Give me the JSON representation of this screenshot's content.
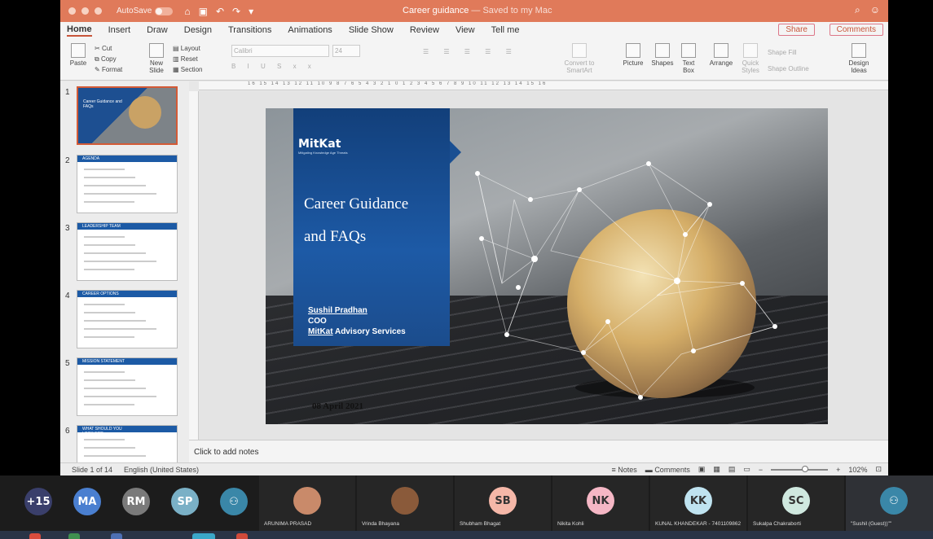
{
  "titlebar": {
    "autosave": "AutoSave",
    "autosave_state": "OFF",
    "doc_title": "Career guidance",
    "saved_status": "— Saved to my Mac"
  },
  "tabs": [
    "Home",
    "Insert",
    "Draw",
    "Design",
    "Transitions",
    "Animations",
    "Slide Show",
    "Review",
    "View",
    "Tell me"
  ],
  "tab_actions": {
    "share": "Share",
    "comments": "Comments"
  },
  "ribbon": {
    "paste": "Paste",
    "cut": "Cut",
    "copy": "Copy",
    "format": "Format",
    "new_slide": "New\nSlide",
    "layout": "Layout",
    "reset": "Reset",
    "section": "Section",
    "font": "Calibri",
    "font_size": "24",
    "convert": "Convert to SmartArt",
    "picture": "Picture",
    "shapes": "Shapes",
    "text_box": "Text Box",
    "arrange": "Arrange",
    "quick_styles": "Quick Styles",
    "shape_fill": "Shape Fill",
    "shape_outline": "Shape Outline",
    "design_ideas": "Design Ideas"
  },
  "ruler_ticks": "16 15 14 13 12 11 10 9 8 7 6 5 4 3 2 1 0 1 2 3 4 5 6 7 8 9 10 11 12 13 14 15 16",
  "thumbs": [
    {
      "num": "1",
      "title": "Career Guidance and FAQs"
    },
    {
      "num": "2",
      "title": "AGENDA"
    },
    {
      "num": "3",
      "title": "LEADERSHIP TEAM"
    },
    {
      "num": "4",
      "title": "CAREER OPTIONS"
    },
    {
      "num": "5",
      "title": "MISSION STATEMENT"
    },
    {
      "num": "6",
      "title": "WHAT SHOULD YOU LOOK FOR"
    }
  ],
  "slide": {
    "logo": "MitKat",
    "logo_tagline": "Mitigating Knowledge Age Threats",
    "title_line1": "Career Guidance",
    "title_line2": "and FAQs",
    "presenter_name": "Sushil Pradhan",
    "presenter_role": "COO",
    "presenter_org_a": "MitKat",
    "presenter_org_b": " Advisory Services",
    "date": "08 April 2021"
  },
  "notes_placeholder": "Click to add notes",
  "status": {
    "slide": "Slide 1 of 14",
    "language": "English (United States)",
    "notes": "Notes",
    "comments": "Comments",
    "zoom": "102%"
  },
  "meeting": {
    "more": "+15",
    "avatars": [
      {
        "initials": "MA",
        "color": "#4a7fd0"
      },
      {
        "initials": "RM",
        "color": "#7a7a7a"
      },
      {
        "initials": "SP",
        "color": "#7ab0c6"
      },
      {
        "initials": "",
        "color": "#3a87a8"
      }
    ],
    "tiles": [
      {
        "name": "ARUNIMA PRASAD",
        "initials": "",
        "color": "#c98a6a",
        "photo": true
      },
      {
        "name": "Vrinda Bhayana",
        "initials": "",
        "color": "#8a5a3a",
        "photo": true
      },
      {
        "name": "Shubham Bhagat",
        "initials": "SB",
        "color": "#f5b7a8"
      },
      {
        "name": "Nikita Kohli",
        "initials": "NK",
        "color": "#f5b7c5"
      },
      {
        "name": "KUNAL KHANDEKAR - 7401109862",
        "initials": "KK",
        "color": "#bfe3f0"
      },
      {
        "name": "Sukalpa Chakraborti",
        "initials": "SC",
        "color": "#cfe8df"
      },
      {
        "name": "\"Sushil (Guest))\"\"",
        "initials": "",
        "color": "#3a87a8"
      }
    ]
  }
}
